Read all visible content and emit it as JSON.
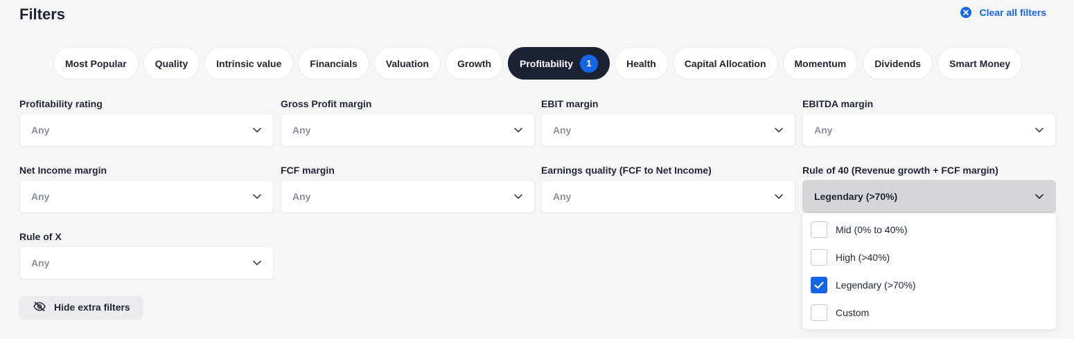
{
  "header": {
    "title": "Filters",
    "clear_all_label": "Clear all filters"
  },
  "tabs": [
    {
      "label": "Most Popular"
    },
    {
      "label": "Quality"
    },
    {
      "label": "Intrinsic value"
    },
    {
      "label": "Financials"
    },
    {
      "label": "Valuation"
    },
    {
      "label": "Growth"
    },
    {
      "label": "Profitability",
      "badge": "1",
      "active": true
    },
    {
      "label": "Health"
    },
    {
      "label": "Capital Allocation"
    },
    {
      "label": "Momentum"
    },
    {
      "label": "Dividends"
    },
    {
      "label": "Smart Money"
    }
  ],
  "filters": [
    {
      "label": "Profitability rating",
      "value": "Any"
    },
    {
      "label": "Gross Profit margin",
      "value": "Any"
    },
    {
      "label": "EBIT margin",
      "value": "Any"
    },
    {
      "label": "EBITDA margin",
      "value": "Any"
    },
    {
      "label": "Net Income margin",
      "value": "Any"
    },
    {
      "label": "FCF margin",
      "value": "Any"
    },
    {
      "label": "Earnings quality (FCF to Net Income)",
      "value": "Any"
    },
    {
      "label": "Rule of 40 (Revenue growth + FCF margin)",
      "value": "Legendary (>70%)",
      "open": true
    },
    {
      "label": "Rule of X",
      "value": "Any"
    }
  ],
  "dropdown_options": [
    {
      "label": "Mid (0% to 40%)",
      "checked": false
    },
    {
      "label": "High (>40%)",
      "checked": false
    },
    {
      "label": "Legendary (>70%)",
      "checked": true
    },
    {
      "label": "Custom",
      "checked": false
    }
  ],
  "hide_extra_label": "Hide extra filters",
  "colors": {
    "accent": "#1565e6",
    "active_tab": "#1b2333",
    "background": "#f6f6f7"
  }
}
